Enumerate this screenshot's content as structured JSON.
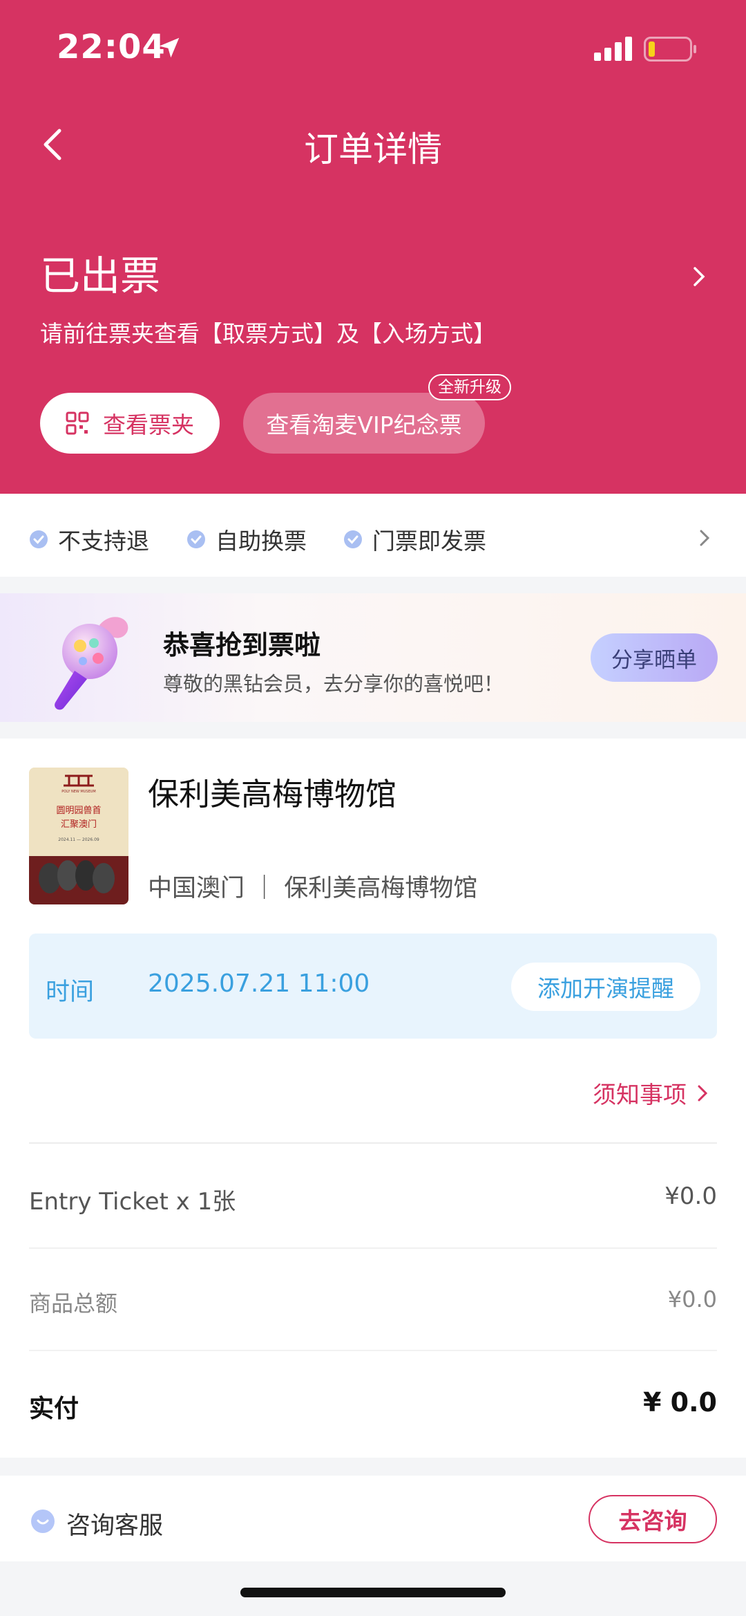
{
  "status_bar": {
    "time": "22:04"
  },
  "header": {
    "title": "订单详情"
  },
  "order_status": {
    "title": "已出票",
    "description": "请前往票夹查看【取票方式】及【入场方式】",
    "wallet_button": "查看票夹",
    "vip_button": "查看淘麦VIP纪念票",
    "vip_badge": "全新升级"
  },
  "features": [
    "不支持退",
    "自助换票",
    "门票即发票"
  ],
  "promo": {
    "title": "恭喜抢到票啦",
    "subtitle": "尊敬的黑钻会员，去分享你的喜悦吧！",
    "share_button": "分享晒单"
  },
  "event": {
    "poster": {
      "museum_name": "POLY NEW MUSEUM",
      "title_line1": "圆明园兽首",
      "title_line2": "汇聚澳门",
      "dates": "2024.11 — 2026.09"
    },
    "title": "保利美高梅博物馆",
    "venue": "中国澳门 ｜ 保利美高梅博物馆",
    "time_label": "时间",
    "time_value": "2025.07.21 11:00",
    "remind_button": "添加开演提醒",
    "notice_link": "须知事项"
  },
  "price": {
    "item_label": "Entry Ticket x 1张",
    "item_value": "¥0.0",
    "subtotal_label": "商品总额",
    "subtotal_value": "¥0.0",
    "paid_label": "实付",
    "paid_value": "¥ 0.0"
  },
  "support": {
    "label": "咨询客服",
    "button": "去咨询"
  },
  "colors": {
    "brand": "#d63362",
    "info_blue": "#3aa0df"
  }
}
